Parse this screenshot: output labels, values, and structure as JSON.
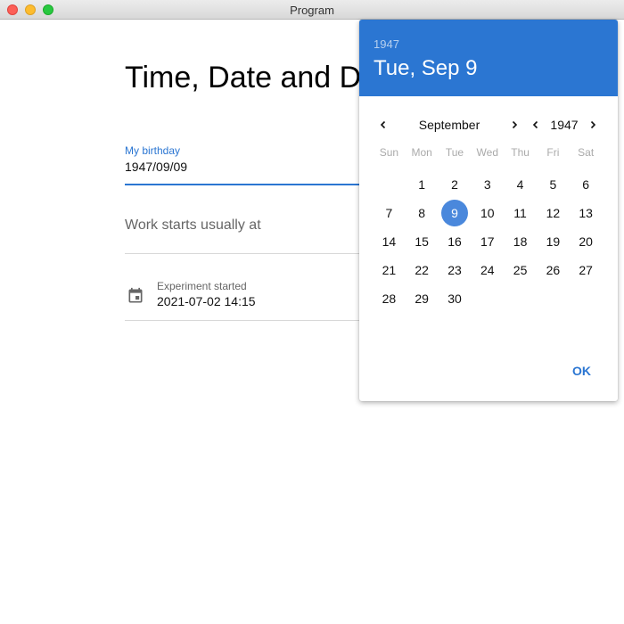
{
  "window": {
    "title": "Program"
  },
  "page": {
    "title": "Time, Date and Date Time"
  },
  "fields": {
    "birthday": {
      "label": "My birthday",
      "value": "1947/09/09"
    },
    "work": {
      "placeholder": "Work starts usually at"
    },
    "experiment": {
      "label": "Experiment started",
      "value": "2021-07-02 14:15",
      "icon": "calendar-icon"
    }
  },
  "picker": {
    "header_year": "1947",
    "header_date": "Tue, Sep 9",
    "month": "September",
    "year": "1947",
    "weekdays": [
      "Sun",
      "Mon",
      "Tue",
      "Wed",
      "Thu",
      "Fri",
      "Sat"
    ],
    "first_day_offset": 1,
    "days_in_month": 30,
    "selected_day": 9,
    "ok_label": "OK",
    "accent_color": "#2b76d2",
    "selected_color": "#4a88dc"
  }
}
